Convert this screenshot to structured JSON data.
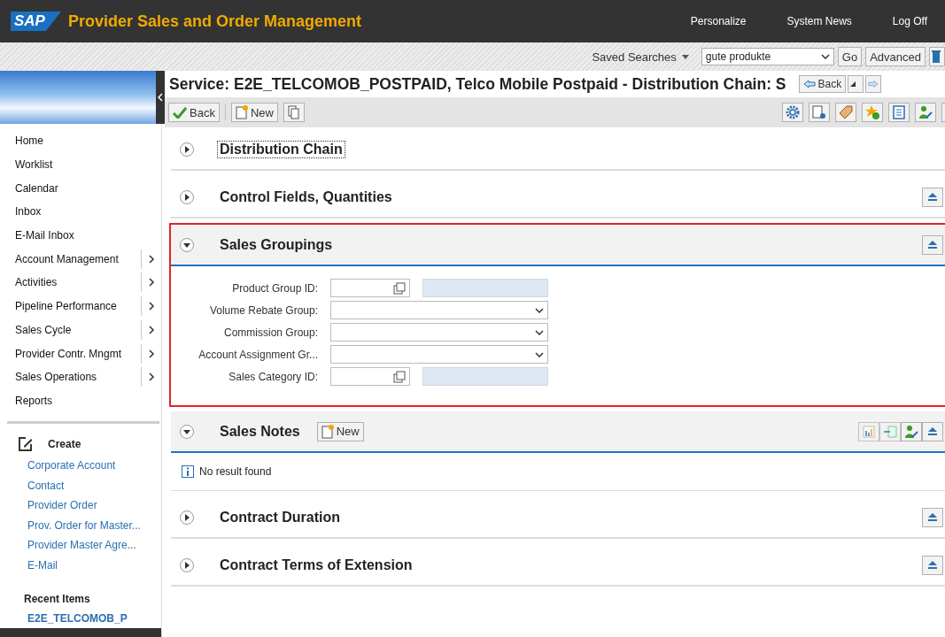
{
  "header": {
    "logo": "SAP",
    "title": "Provider Sales and Order Management",
    "links": [
      "Personalize",
      "System News",
      "Log Off"
    ]
  },
  "search_bar": {
    "saved_searches": "Saved Searches",
    "value": "gute produkte",
    "go": "Go",
    "advanced": "Advanced"
  },
  "sidebar": {
    "items": [
      {
        "label": "Home",
        "submenu": false
      },
      {
        "label": "Worklist",
        "submenu": false
      },
      {
        "label": "Calendar",
        "submenu": false
      },
      {
        "label": "Inbox",
        "submenu": false
      },
      {
        "label": "E-Mail Inbox",
        "submenu": false
      },
      {
        "label": "Account Management",
        "submenu": true
      },
      {
        "label": "Activities",
        "submenu": true
      },
      {
        "label": "Pipeline Performance",
        "submenu": true
      },
      {
        "label": "Sales Cycle",
        "submenu": true
      },
      {
        "label": "Provider Contr. Mngmt",
        "submenu": true
      },
      {
        "label": "Sales Operations",
        "submenu": true
      },
      {
        "label": "Reports",
        "submenu": false
      }
    ],
    "create": {
      "title": "Create",
      "links": [
        "Corporate Account",
        "Contact",
        "Provider Order",
        "Prov. Order for Master...",
        "Provider Master Agre...",
        "E-Mail"
      ]
    },
    "recent": {
      "title": "Recent Items",
      "items": [
        "E2E_TELCOMOB_P"
      ]
    }
  },
  "page": {
    "title": "Service: E2E_TELCOMOB_POSTPAID, Telco Mobile Postpaid - Distribution Chain: S",
    "history_back": "Back",
    "toolbar": {
      "back": "Back",
      "new": "New"
    }
  },
  "sections": [
    {
      "title": "Distribution Chain",
      "expanded": false,
      "focused": true,
      "highlighted": false,
      "kind": "plain"
    },
    {
      "title": "Control Fields, Quantities",
      "expanded": false,
      "focused": false,
      "highlighted": false,
      "kind": "plain"
    },
    {
      "title": "Sales Groupings",
      "expanded": true,
      "focused": false,
      "highlighted": true,
      "kind": "form",
      "fields": [
        {
          "label": "Product Group ID:",
          "kind": "lookup"
        },
        {
          "label": "Volume Rebate Group:",
          "kind": "dropdown"
        },
        {
          "label": "Commission Group:",
          "kind": "dropdown"
        },
        {
          "label": "Account Assignment Gr...",
          "kind": "dropdown"
        },
        {
          "label": "Sales Category ID:",
          "kind": "lookup"
        }
      ]
    },
    {
      "title": "Sales Notes",
      "expanded": true,
      "focused": false,
      "highlighted": false,
      "kind": "notes",
      "new_button": "New",
      "message": "No result found"
    },
    {
      "title": "Contract Duration",
      "expanded": false,
      "focused": false,
      "highlighted": false,
      "kind": "plain"
    },
    {
      "title": "Contract Terms of Extension",
      "expanded": false,
      "focused": false,
      "highlighted": false,
      "kind": "plain"
    }
  ]
}
